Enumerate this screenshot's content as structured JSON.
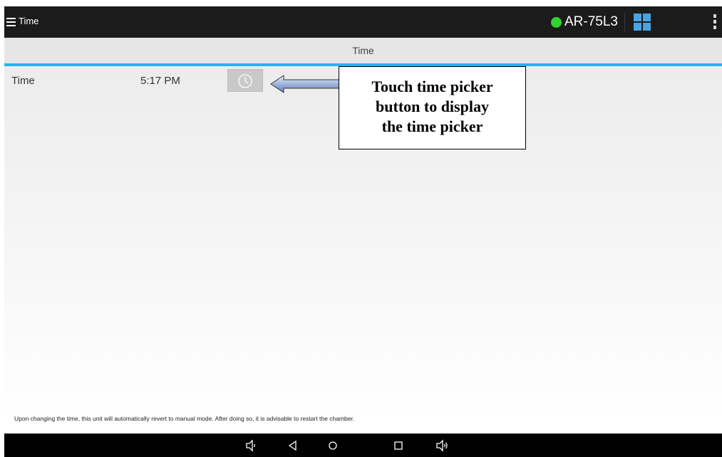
{
  "topbar": {
    "title": "Time",
    "device_name": "AR-75L3",
    "status_color": "#2fd42f",
    "icons": [
      "menu-icon",
      "status-dot",
      "grid-icon",
      "overflow-menu-icon"
    ]
  },
  "subheader": {
    "title": "Time"
  },
  "row": {
    "label": "Time",
    "value": "5:17 PM",
    "button_icon": "clock-icon"
  },
  "callout": {
    "lines": [
      "Touch time picker",
      "button to display",
      "the time picker"
    ]
  },
  "footnote": "Upon changing the time, this unit will automatically revert to manual mode.  After doing so, it is advisable to restart the chamber.",
  "accent_color": "#29b3ea",
  "navbar": {
    "icons": [
      "volume-down-icon",
      "back-icon",
      "home-icon",
      "recents-icon",
      "volume-up-icon"
    ]
  }
}
